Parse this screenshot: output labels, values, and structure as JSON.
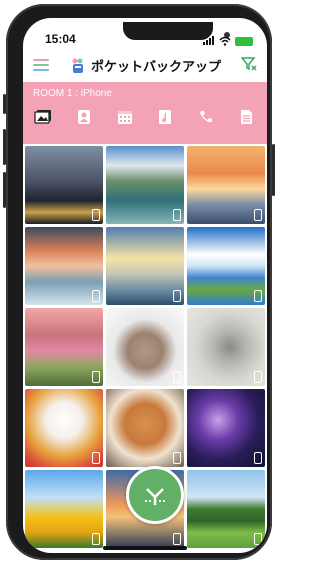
{
  "status": {
    "time": "15:04"
  },
  "app": {
    "title": "ポケットバックアップ"
  },
  "room": {
    "label": "ROOM 1 : iPhone"
  },
  "tabs": [
    {
      "name": "photos",
      "active": true
    },
    {
      "name": "contacts"
    },
    {
      "name": "calendar"
    },
    {
      "name": "music"
    },
    {
      "name": "phone"
    },
    {
      "name": "documents"
    }
  ],
  "colors": {
    "accent": "#f4a2b6",
    "fab": "#62b065",
    "menu_top": "#f29bb0",
    "menu_mid": "#7cc7a3",
    "menu_bot": "#7ab7e8"
  },
  "photos": [
    "city-night",
    "mountain-lake",
    "sunset-sea",
    "cloudy-sea",
    "sunrise-beach",
    "blue-sky-lake",
    "cherry-blossom",
    "hamster",
    "cat",
    "pomeranian",
    "shiba-puppy",
    "galaxy",
    "sunflowers",
    "sunset-gradient",
    "tree-field"
  ]
}
